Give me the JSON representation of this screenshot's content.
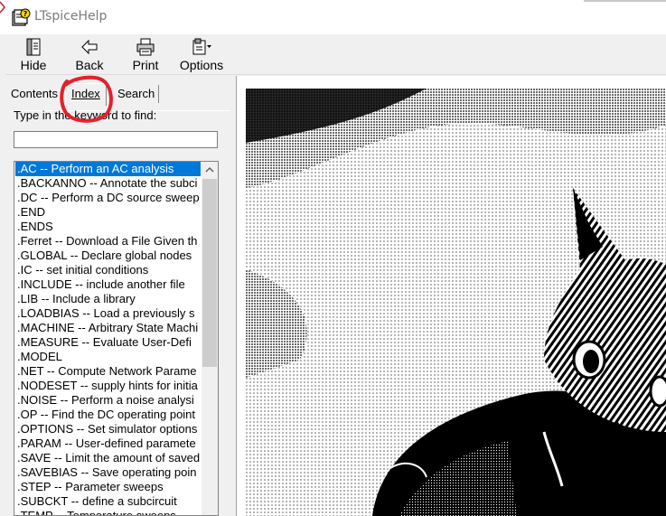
{
  "window": {
    "title": "LTspiceHelp"
  },
  "toolbar": {
    "hide_label": "Hide",
    "back_label": "Back",
    "print_label": "Print",
    "options_label": "Options"
  },
  "tabs": {
    "contents": "Contents",
    "index": "Index",
    "search": "Search"
  },
  "index_panel": {
    "prompt": "Type in the keyword to find:",
    "keyword_value": "",
    "items": [
      ".AC -- Perform an AC analysis",
      ".BACKANNO -- Annotate the subci",
      ".DC -- Perform a DC source sweep",
      ".END",
      ".ENDS",
      ".Ferret -- Download a File Given th",
      ".GLOBAL -- Declare global nodes",
      ".IC  -- set initial conditions",
      ".INCLUDE -- include another file",
      ".LIB -- Include a library",
      ".LOADBIAS -- Load a previously s",
      ".MACHINE -- Arbitrary State Machi",
      ".MEASURE -- Evaluate User-Defi",
      ".MODEL",
      ".NET  -- Compute Network Parame",
      ".NODESET -- supply hints for initia",
      ".NOISE  -- Perform a noise analysi",
      ".OP  -- Find the DC operating point",
      ".OPTIONS -- Set simulator options",
      ".PARAM  -- User-defined paramete",
      ".SAVE  -- Limit the amount of saved",
      ".SAVEBIAS -- Save operating poin",
      ".STEP -- Parameter sweeps",
      ".SUBCKT  -- define a subcircuit",
      ".TEMP -- Temperature sweeps"
    ],
    "selected_index": 0
  },
  "colors": {
    "selection": "#0078d7",
    "annotation": "#e5202a"
  },
  "content": {
    "image_subject": "dithered cat photo"
  }
}
